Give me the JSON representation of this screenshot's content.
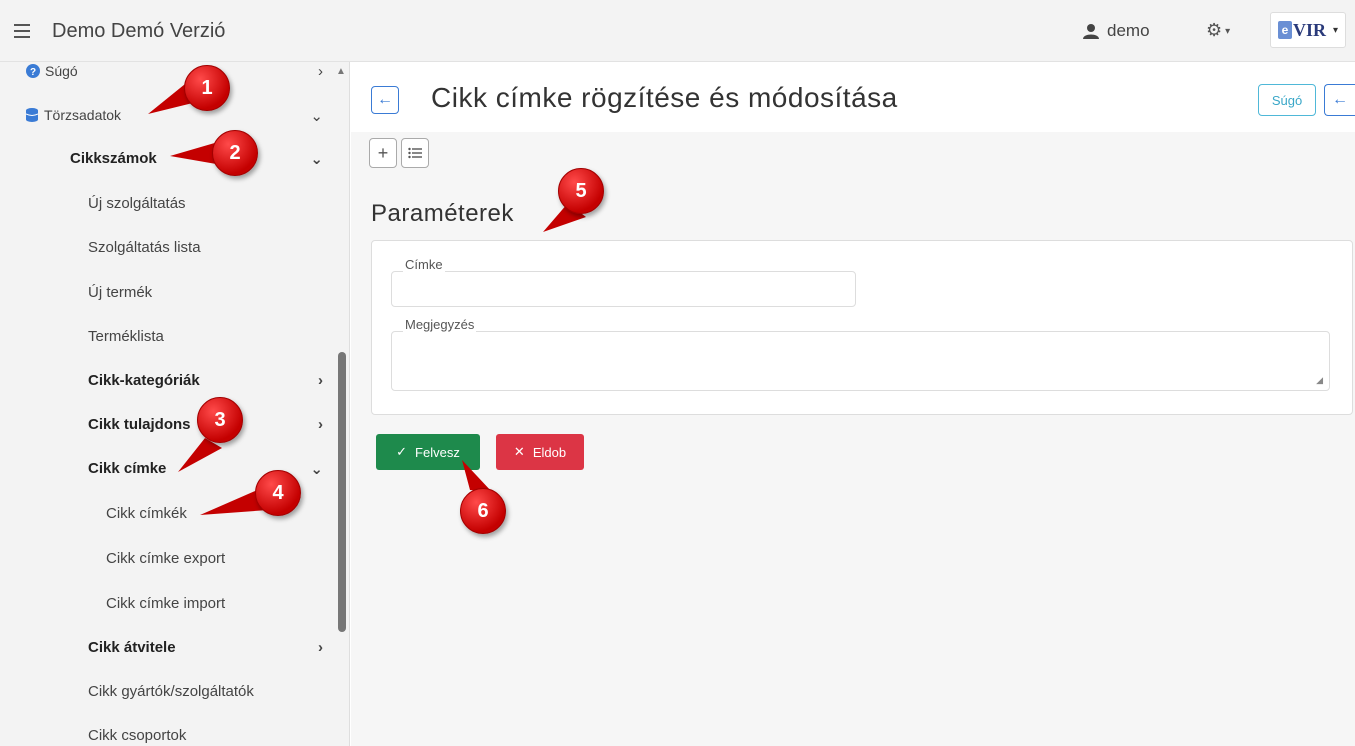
{
  "topbar": {
    "title": "Demo Demó Verzió",
    "user": "demo",
    "logo_text": "VIR",
    "logo_prefix": "e"
  },
  "sidebar": {
    "items": [
      {
        "label": "Súgó",
        "icon": "help-circle-icon"
      },
      {
        "label": "Törzsadatok",
        "icon": "database-icon"
      },
      {
        "label": "Cikkszámok"
      },
      {
        "label": "Új szolgáltatás"
      },
      {
        "label": "Szolgáltatás lista"
      },
      {
        "label": "Új termék"
      },
      {
        "label": "Terméklista"
      },
      {
        "label": "Cikk-kategóriák"
      },
      {
        "label": "Cikk tulajdons"
      },
      {
        "label": "Cikk címke"
      },
      {
        "label": "Cikk címkék"
      },
      {
        "label": "Cikk címke export"
      },
      {
        "label": "Cikk címke import"
      },
      {
        "label": "Cikk átvitele"
      },
      {
        "label": "Cikk gyártók/szolgáltatók"
      },
      {
        "label": "Cikk csoportok"
      }
    ]
  },
  "main": {
    "title": "Cikk címke rögzítése és módosítása",
    "help_label": "Súgó",
    "section_title": "Paraméterek",
    "fields": {
      "tag_label": "Címke",
      "tag_value": "",
      "note_label": "Megjegyzés",
      "note_value": ""
    },
    "buttons": {
      "save": "Felvesz",
      "discard": "Eldob"
    }
  },
  "markers": [
    "1",
    "2",
    "3",
    "4",
    "5",
    "6"
  ],
  "colors": {
    "primary": "#3a7bd5",
    "success": "#1e8a4c",
    "danger": "#dc3545",
    "info": "#3aa7c8",
    "marker": "#d10000"
  }
}
